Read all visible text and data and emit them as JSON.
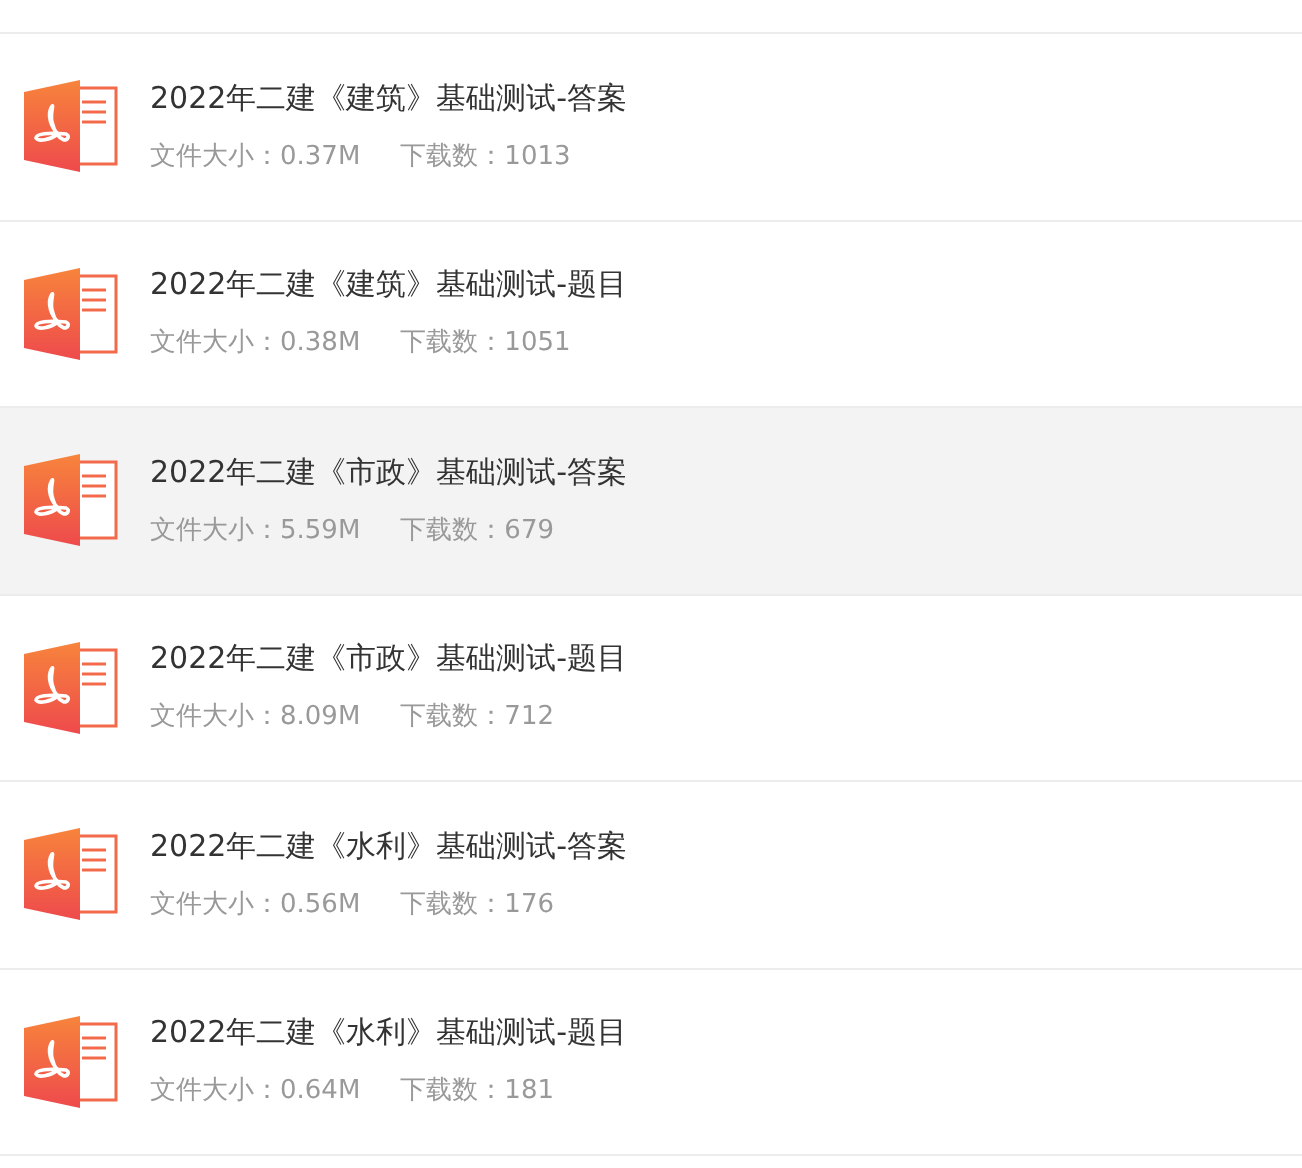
{
  "files": [
    {
      "title": "2022年二建《建筑》基础测试-答案",
      "size_label": "文件大小：",
      "size": "0.37M",
      "downloads_label": "下载数：",
      "downloads": "1013",
      "highlighted": false
    },
    {
      "title": "2022年二建《建筑》基础测试-题目",
      "size_label": "文件大小：",
      "size": "0.38M",
      "downloads_label": "下载数：",
      "downloads": "1051",
      "highlighted": false
    },
    {
      "title": "2022年二建《市政》基础测试-答案",
      "size_label": "文件大小：",
      "size": "5.59M",
      "downloads_label": "下载数：",
      "downloads": "679",
      "highlighted": true
    },
    {
      "title": "2022年二建《市政》基础测试-题目",
      "size_label": "文件大小：",
      "size": "8.09M",
      "downloads_label": "下载数：",
      "downloads": "712",
      "highlighted": false
    },
    {
      "title": "2022年二建《水利》基础测试-答案",
      "size_label": "文件大小：",
      "size": "0.56M",
      "downloads_label": "下载数：",
      "downloads": "176",
      "highlighted": false
    },
    {
      "title": "2022年二建《水利》基础测试-题目",
      "size_label": "文件大小：",
      "size": "0.64M",
      "downloads_label": "下载数：",
      "downloads": "181",
      "highlighted": false
    }
  ]
}
